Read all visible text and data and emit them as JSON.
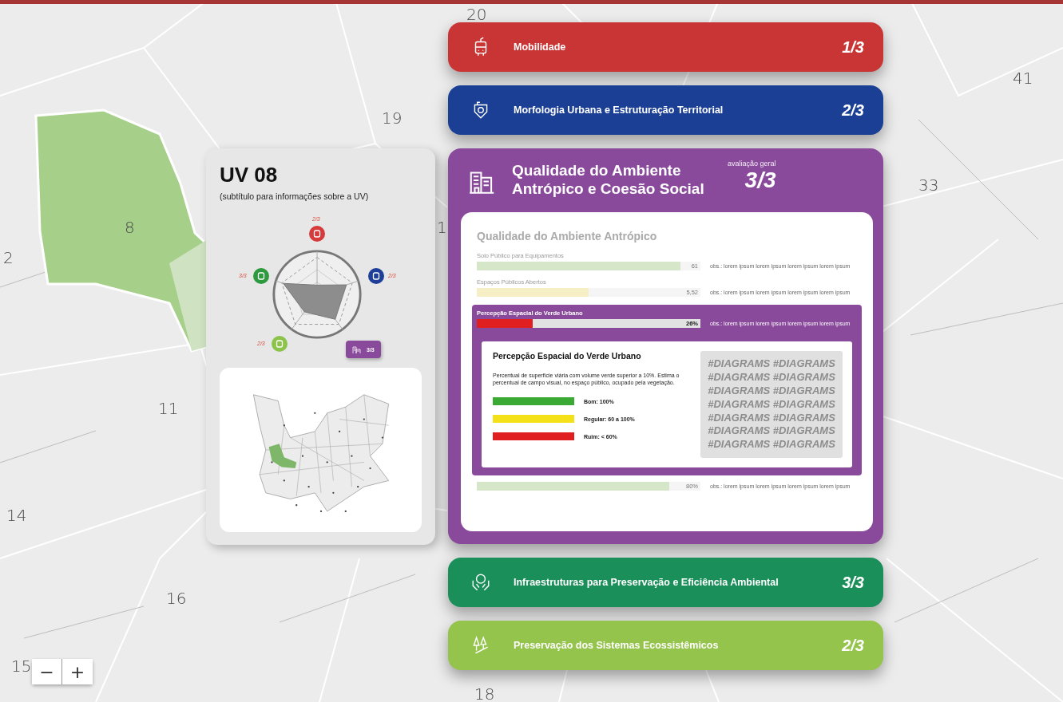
{
  "map_labels": [
    "20",
    "41",
    "19",
    "33",
    "8",
    "2",
    "1",
    "11",
    "14",
    "16",
    "15",
    "18"
  ],
  "zoom": {
    "out": "−",
    "in": "+"
  },
  "uv_card": {
    "title": "UV 08",
    "subtitle": "(subtítulo para informações sobre a UV)",
    "radar": [
      {
        "score": "2/3",
        "color": "#d63a3a",
        "selected": false
      },
      {
        "score": "2/3",
        "color": "#1e3f99",
        "selected": false
      },
      {
        "score": "3/3",
        "color": "#8a4a9b",
        "selected": true
      },
      {
        "score": "2/3",
        "color": "#8cc34a",
        "selected": false
      },
      {
        "score": "3/3",
        "color": "#2e9a40",
        "selected": false
      }
    ]
  },
  "categories": [
    {
      "title": "Mobilidade",
      "score": "1/3",
      "color": "#c93535",
      "expanded": false
    },
    {
      "title": "Morfologia Urbana e Estruturação Territorial",
      "score": "2/3",
      "color": "#1a3f94",
      "expanded": false
    },
    {
      "title": "Qualidade do Ambiente Antrópico e Coesão Social",
      "score": "3/3",
      "color": "#8a4a9b",
      "expanded": true,
      "score_caption": "avaliação geral",
      "panel": {
        "title": "Qualidade do Ambiente Antrópico",
        "indicators": [
          {
            "label": "Solo Público para Equipamentos",
            "level": 0.91,
            "value": "61",
            "color": "#d6e6c9",
            "note": "obs.: lorem ipsum lorem ipsum lorem ipsum lorem ipsum",
            "selected": false
          },
          {
            "label": "Espaços Públicos Abertos",
            "level": 0.5,
            "value": "5,52",
            "color": "#f6efc6",
            "note": "obs.: lorem ipsum lorem ipsum lorem ipsum lorem ipsum",
            "selected": false
          },
          {
            "label": "Percepção Espacial do Verde Urbano",
            "level": 0.25,
            "value": "26%",
            "color": "#e02020",
            "note": "obs.: lorem ipsum lorem ipsum lorem ipsum lorem ipsum",
            "selected": true,
            "detail": {
              "title": "Percepção Espacial do Verde Urbano",
              "description": "Percentual de superfície viária com volume verde superior a 10%. Estima o percentual de campo visual, no espaço público, ocupado pela vegetação.",
              "legend": [
                {
                  "color": "#3aaa35",
                  "text": "Bom: 100%"
                },
                {
                  "color": "#f5e11a",
                  "text": "Regular: 60 a 100%"
                },
                {
                  "color": "#e02020",
                  "text": "Ruim: < 60%"
                }
              ],
              "diagram_lines": [
                "#DIAGRAMS #DIAGRAMS",
                "#DIAGRAMS #DIAGRAMS",
                "#DIAGRAMS #DIAGRAMS",
                "#DIAGRAMS #DIAGRAMS",
                "#DIAGRAMS #DIAGRAMS",
                "#DIAGRAMS #DIAGRAMS",
                "#DIAGRAMS #DIAGRAMS"
              ]
            }
          },
          {
            "level": 0.86,
            "value": "80%",
            "color": "#d6e6c9",
            "note": "obs.: lorem ipsum lorem ipsum lorem ipsum lorem ipsum",
            "selected": false
          }
        ]
      }
    },
    {
      "title": "Infraestruturas para Preservação e Eficiência Ambiental",
      "score": "3/3",
      "color": "#1a8f5a",
      "expanded": false
    },
    {
      "title": "Preservação dos Sistemas Ecossistêmicos",
      "score": "2/3",
      "color": "#95c44c",
      "expanded": false
    }
  ]
}
